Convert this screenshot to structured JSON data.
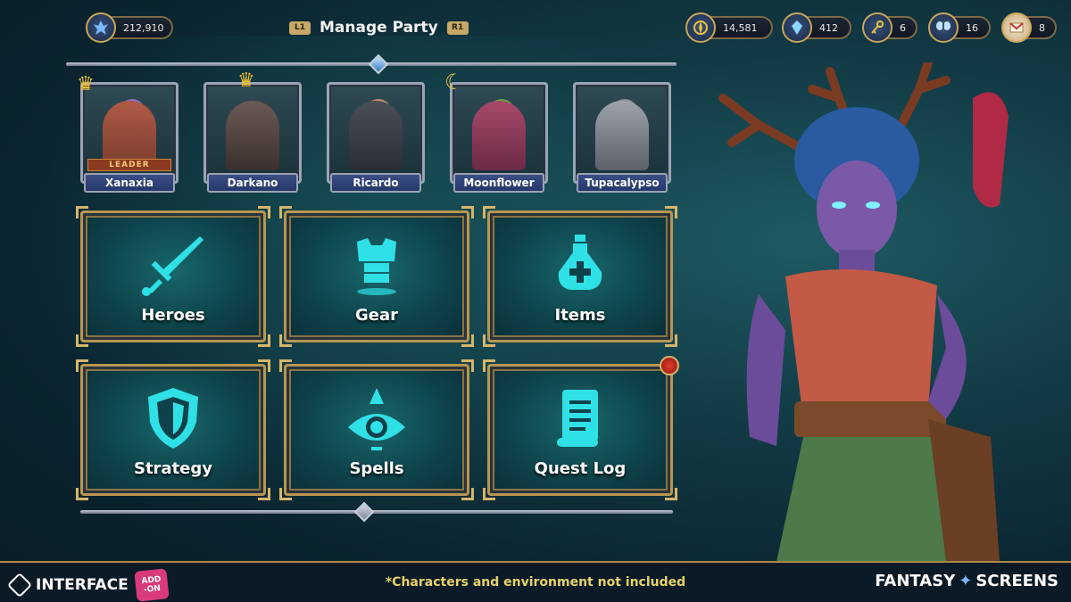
{
  "header": {
    "title": "Manage Party",
    "left_bumper": "L1",
    "right_bumper": "R1",
    "gold": "212,910"
  },
  "currencies": [
    {
      "icon": "compass-coin-icon",
      "value": "14,581"
    },
    {
      "icon": "crystal-icon",
      "value": "412"
    },
    {
      "icon": "key-icon",
      "value": "6"
    },
    {
      "icon": "butterfly-icon",
      "value": "16"
    },
    {
      "icon": "mail-icon",
      "value": "8"
    }
  ],
  "party": [
    {
      "name": "Xanaxia",
      "leader": "LEADER"
    },
    {
      "name": "Darkano"
    },
    {
      "name": "Ricardo"
    },
    {
      "name": "Moonflower"
    },
    {
      "name": "Tupacalypso"
    }
  ],
  "menu": [
    {
      "label": "Heroes",
      "icon": "sword-icon"
    },
    {
      "label": "Gear",
      "icon": "armor-icon"
    },
    {
      "label": "Items",
      "icon": "potion-icon"
    },
    {
      "label": "Strategy",
      "icon": "shield-icon"
    },
    {
      "label": "Spells",
      "icon": "eye-pyramid-icon"
    },
    {
      "label": "Quest Log",
      "icon": "scroll-icon"
    }
  ],
  "footer": {
    "brand_left": "INTERFACE",
    "addon_line1": "ADD",
    "addon_line2": "ON",
    "disclaimer": "*Characters and environment not included",
    "brand_right_a": "FANTASY",
    "brand_right_b": "SCREENS"
  },
  "colors": {
    "accent_gold": "#b8964f",
    "tile_teal": "#17676b",
    "icon_cyan": "#2fe0e6",
    "name_plate": "#3a4f85",
    "disclaimer_yellow": "#e6d36a"
  }
}
